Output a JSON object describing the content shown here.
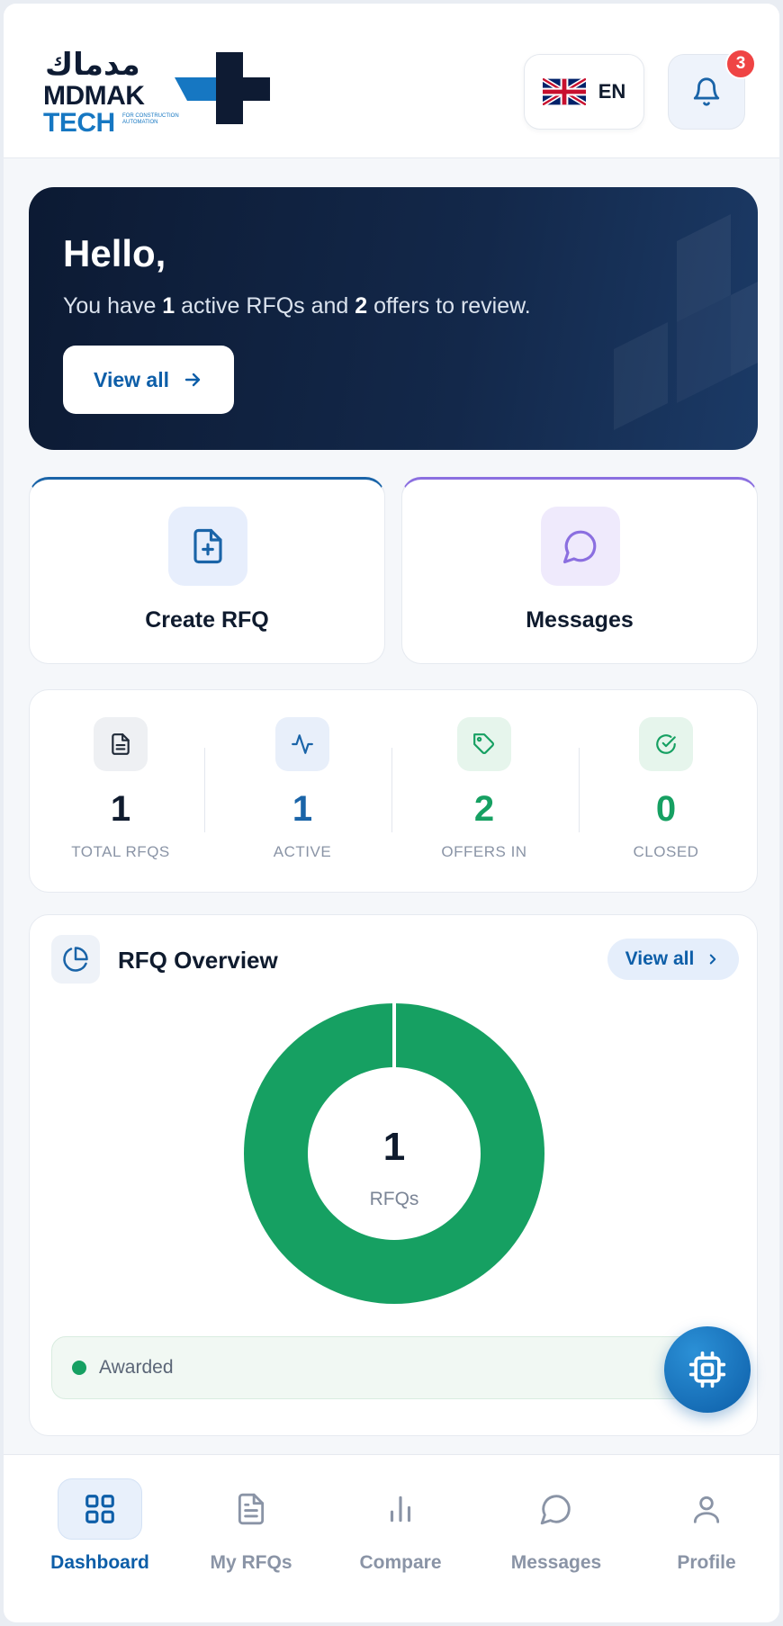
{
  "header": {
    "logo": {
      "arabic": "مدماك",
      "line1": "MDMAK",
      "line2": "TECH",
      "tagline": "FOR CONSTRUCTION AUTOMATION"
    },
    "language": {
      "code": "EN",
      "flag_icon": "uk-flag-icon"
    },
    "notifications": {
      "count": "3",
      "icon": "bell-icon"
    }
  },
  "hero": {
    "greeting": "Hello,",
    "sub_prefix": "You have ",
    "active_rfqs": "1",
    "sub_middle": " active RFQs and ",
    "offers": "2",
    "sub_suffix": " offers to review.",
    "button_label": "View all"
  },
  "actions": [
    {
      "label": "Create RFQ",
      "icon": "file-plus-icon",
      "accent": "#1a64a8"
    },
    {
      "label": "Messages",
      "icon": "chat-bubble-icon",
      "accent": "#8b6fe0"
    }
  ],
  "stats": [
    {
      "value": "1",
      "label": "TOTAL RFQS",
      "icon": "document-icon",
      "color": "#0f1b2e"
    },
    {
      "value": "1",
      "label": "ACTIVE",
      "icon": "activity-icon",
      "color": "#1a64a8"
    },
    {
      "value": "2",
      "label": "OFFERS IN",
      "icon": "tag-icon",
      "color": "#16a062"
    },
    {
      "value": "0",
      "label": "CLOSED",
      "icon": "check-circle-icon",
      "color": "#16a062"
    }
  ],
  "overview": {
    "title": "RFQ Overview",
    "view_all": "View all",
    "center_value": "1",
    "center_label": "RFQs",
    "legend": [
      {
        "label": "Awarded",
        "color": "#16a062"
      }
    ]
  },
  "chart_data": {
    "type": "pie",
    "categories": [
      "Awarded"
    ],
    "values": [
      1
    ]
  },
  "fab": {
    "icon": "chip-icon"
  },
  "nav": [
    {
      "label": "Dashboard",
      "icon": "grid-icon",
      "active": true
    },
    {
      "label": "My RFQs",
      "icon": "file-list-icon",
      "active": false
    },
    {
      "label": "Compare",
      "icon": "bar-chart-icon",
      "active": false
    },
    {
      "label": "Messages",
      "icon": "chat-bubble-icon",
      "active": false
    },
    {
      "label": "Profile",
      "icon": "user-icon",
      "active": false
    }
  ]
}
